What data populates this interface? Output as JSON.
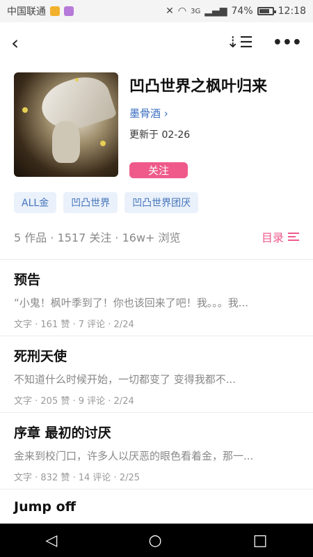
{
  "status": {
    "carrier": "中国联通",
    "battery": "74%",
    "time": "12:18",
    "network": "3G"
  },
  "topbar": {
    "back_icon": "chevron-left-icon",
    "sort_icon": "sort-list-icon",
    "more_icon": "more-dots-icon"
  },
  "book": {
    "title": "凹凸世界之枫叶归来",
    "author": "墨骨酒",
    "updated": "更新于 02-26",
    "follow_label": "关注"
  },
  "tags": [
    "ALL金",
    "凹凸世界",
    "凹凸世界团厌"
  ],
  "stats": {
    "text": "5 作品 · 1517 关注 · 16w+ 浏览",
    "toc_label": "目录"
  },
  "chapters": [
    {
      "title": "预告",
      "excerpt": "“小鬼！枫叶季到了！你也该回来了吧！我。。。我...",
      "meta": "文字 · 161 赞 · 7 评论 · 2/24"
    },
    {
      "title": "死刑天使",
      "excerpt": "不知道什么时候开始，一切都变了        变得我都不...",
      "meta": "文字 · 205 赞 · 9 评论 · 2/24"
    },
    {
      "title": "序章 最初的讨厌",
      "excerpt": "金来到校门口，许多人以厌恶的眼色看着金，那一...",
      "meta": "文字 · 832 赞 · 14 评论 · 2/25"
    },
    {
      "title": "Jump off",
      "excerpt": "",
      "meta": ""
    }
  ],
  "colors": {
    "accent": "#ef5a8b",
    "link": "#3b6fc0",
    "tag_bg": "#eaf1fb"
  }
}
